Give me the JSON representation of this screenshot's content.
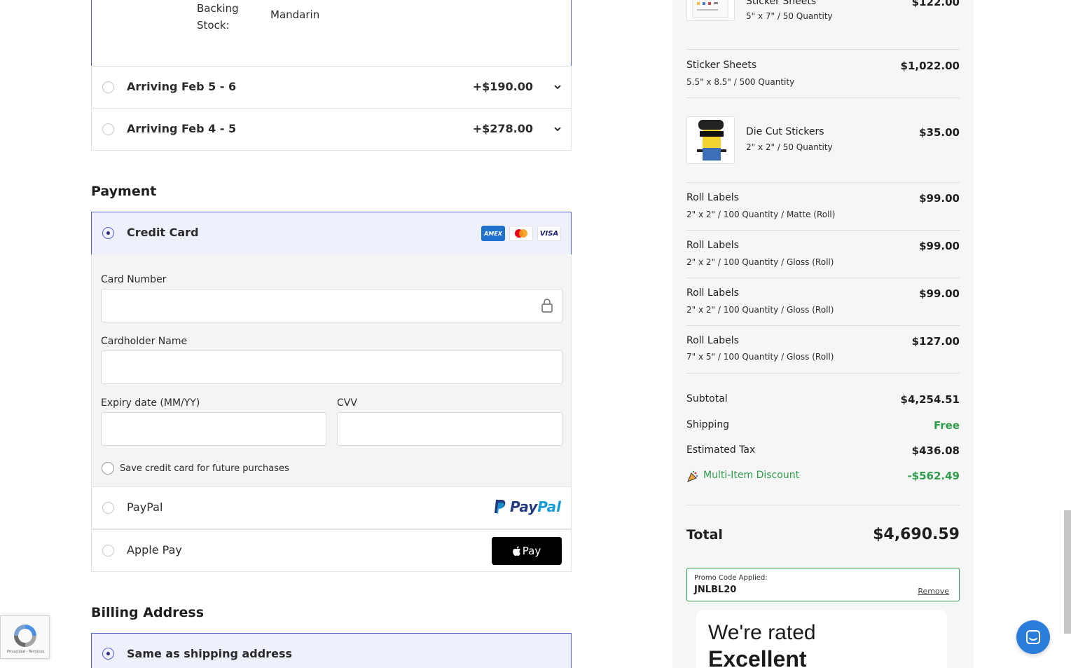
{
  "shipping": {
    "backing_label": "Backing Stock:",
    "backing_value": "Mandarin",
    "options": [
      {
        "label": "Arriving Feb 5 - 6",
        "price": "+$190.00"
      },
      {
        "label": "Arriving Feb 4 - 5",
        "price": "+$278.00"
      }
    ]
  },
  "payment": {
    "title": "Payment",
    "credit_card_label": "Credit Card",
    "card_brands": [
      "AMEX",
      "VISA"
    ],
    "card_number_label": "Card Number",
    "cardholder_label": "Cardholder Name",
    "expiry_label": "Expiry date (MM/YY)",
    "cvv_label": "CVV",
    "save_label": "Save credit card for future purchases",
    "paypal_label": "PayPal",
    "paypal_logo_a": "Pay",
    "paypal_logo_b": "Pal",
    "apple_pay_label": "Apple Pay",
    "apple_pay_button": "Pay"
  },
  "billing": {
    "title": "Billing Address",
    "same_as_shipping": "Same as shipping address"
  },
  "summary": {
    "items": [
      {
        "name": "Sticker Sheets",
        "sub": "5\" x 7\" / 50 Quantity",
        "price": "$122.00"
      },
      {
        "name": "Sticker Sheets",
        "sub": "5.5\" x 8.5\" / 500 Quantity",
        "price": "$1,022.00"
      },
      {
        "name": "Die Cut Stickers",
        "sub": "2\" x 2\" / 50 Quantity",
        "price": "$35.00"
      },
      {
        "name": "Roll Labels",
        "sub": "2\" x 2\" / 100 Quantity / Matte (Roll)",
        "price": "$99.00"
      },
      {
        "name": "Roll Labels",
        "sub": "2\" x 2\" / 100 Quantity / Gloss (Roll)",
        "price": "$99.00"
      },
      {
        "name": "Roll Labels",
        "sub": "2\" x 2\" / 100 Quantity / Gloss (Roll)",
        "price": "$99.00"
      },
      {
        "name": "Roll Labels",
        "sub": "7\" x 5\" / 100 Quantity / Gloss (Roll)",
        "price": "$127.00"
      }
    ],
    "subtotal_label": "Subtotal",
    "subtotal_value": "$4,254.51",
    "shipping_label": "Shipping",
    "shipping_value": "Free",
    "tax_label": "Estimated Tax",
    "tax_value": "$436.08",
    "discount_label": "Multi-Item Discount",
    "discount_value": "-$562.49",
    "total_label": "Total",
    "total_value": "$4,690.59",
    "promo_label": "Promo Code Applied:",
    "promo_code": "JNLBL20",
    "promo_remove": "Remove",
    "rated_line1": "We're rated",
    "rated_line2": "Excellent"
  },
  "recaptcha": {
    "text": "Privacidad - Términos"
  },
  "colors": {
    "accent": "#5b63d3",
    "selected_bg": "#eef0fb",
    "green": "#2e9e4c",
    "chat": "#2b7ddb"
  }
}
